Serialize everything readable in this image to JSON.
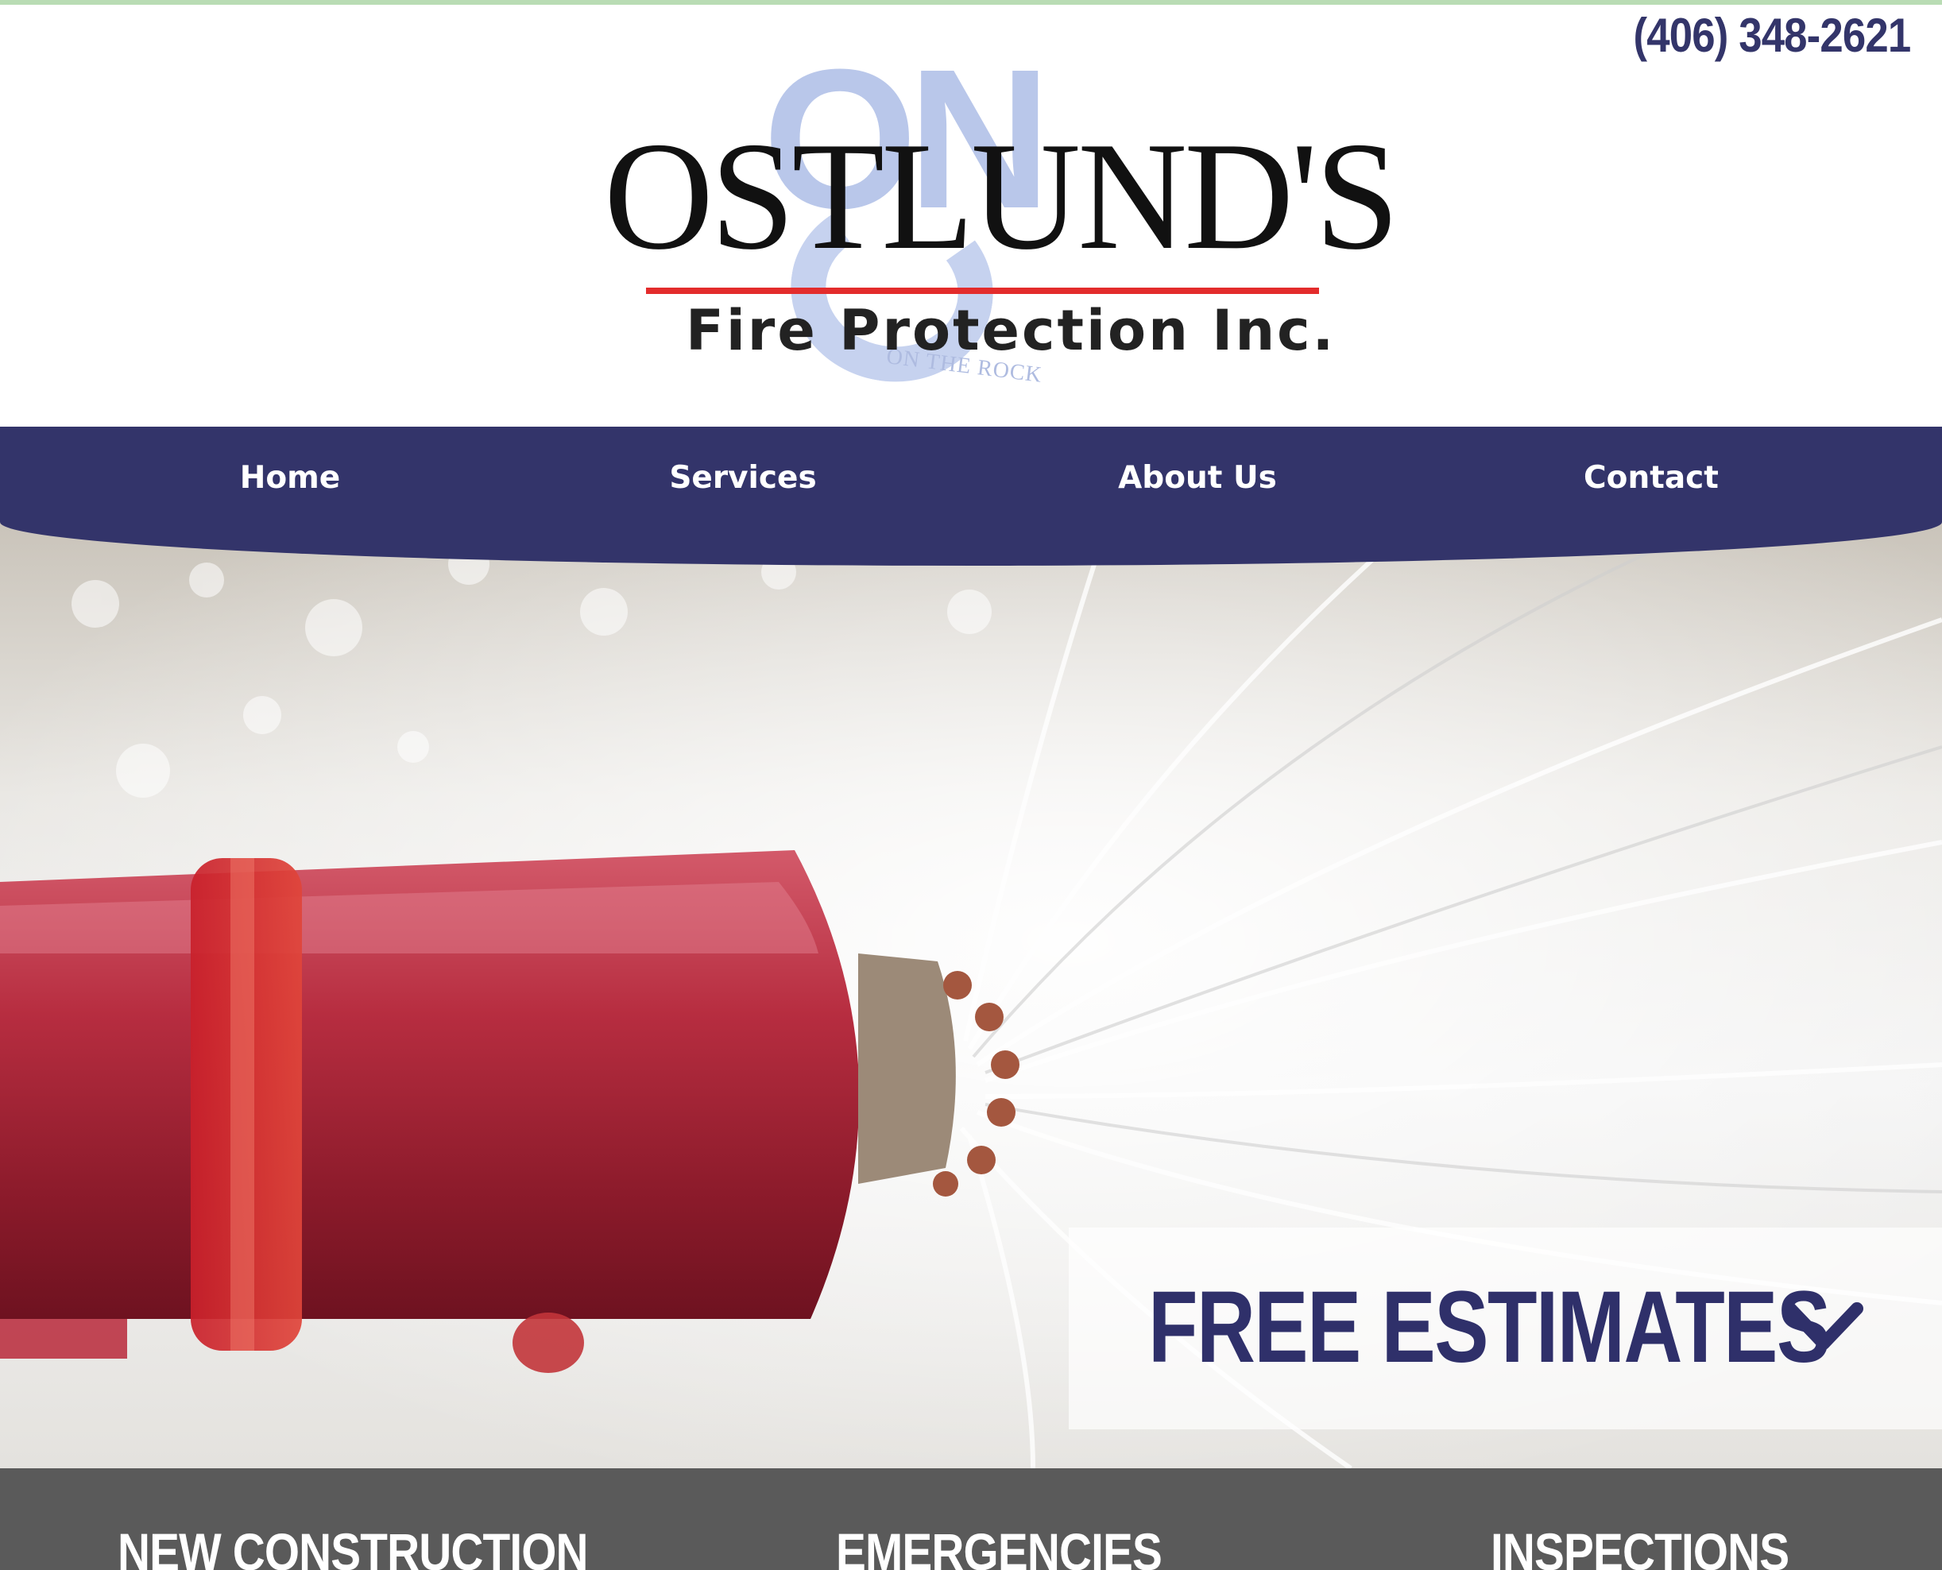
{
  "header": {
    "phone": "(406) 348-2621"
  },
  "logo": {
    "mark": "ON",
    "name": "OSTLUND'S",
    "subtitle": "Fire Protection Inc.",
    "tagline": "ON THE ROCK"
  },
  "nav": {
    "items": [
      {
        "label": "Home"
      },
      {
        "label": "Services"
      },
      {
        "label": "About Us"
      },
      {
        "label": "Contact"
      }
    ]
  },
  "hero": {
    "cta_label": "FREE ESTIMATES",
    "cta_icon": "chevron-down-icon"
  },
  "features": {
    "items": [
      {
        "title": "NEW CONSTRUCTION"
      },
      {
        "title": "EMERGENCIES"
      },
      {
        "title": "INSPECTIONS"
      }
    ]
  },
  "colors": {
    "brand_navy": "#33346a",
    "logo_red": "#e32c2c",
    "logo_light_blue": "#b9c7ea",
    "features_bar": "#5a5a5a"
  }
}
